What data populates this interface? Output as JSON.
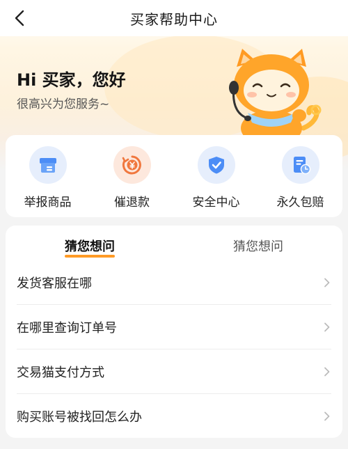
{
  "nav": {
    "title": "买家帮助中心"
  },
  "hero": {
    "greeting": "Hi 买家，您好",
    "subtitle": "很高兴为您服务~"
  },
  "quick_actions": [
    {
      "label": "举报商品",
      "icon": "report-box-icon",
      "color": "#4c8df6"
    },
    {
      "label": "催退款",
      "icon": "refund-yen-icon",
      "color": "#f0773e"
    },
    {
      "label": "安全中心",
      "icon": "shield-check-icon",
      "color": "#4c8df6"
    },
    {
      "label": "永久包赔",
      "icon": "document-clock-icon",
      "color": "#4c8df6"
    }
  ],
  "faq": {
    "tabs": [
      {
        "label": "猜您想问",
        "active": true
      },
      {
        "label": "猜您想问",
        "active": false
      }
    ],
    "items": [
      {
        "label": "发货客服在哪"
      },
      {
        "label": "在哪里查询订单号"
      },
      {
        "label": "交易猫支付方式"
      },
      {
        "label": "购买账号被找回怎么办"
      }
    ]
  },
  "colors": {
    "accent": "#ff9b26",
    "icon_blue": "#4c8df6",
    "icon_orange": "#f0773e"
  }
}
